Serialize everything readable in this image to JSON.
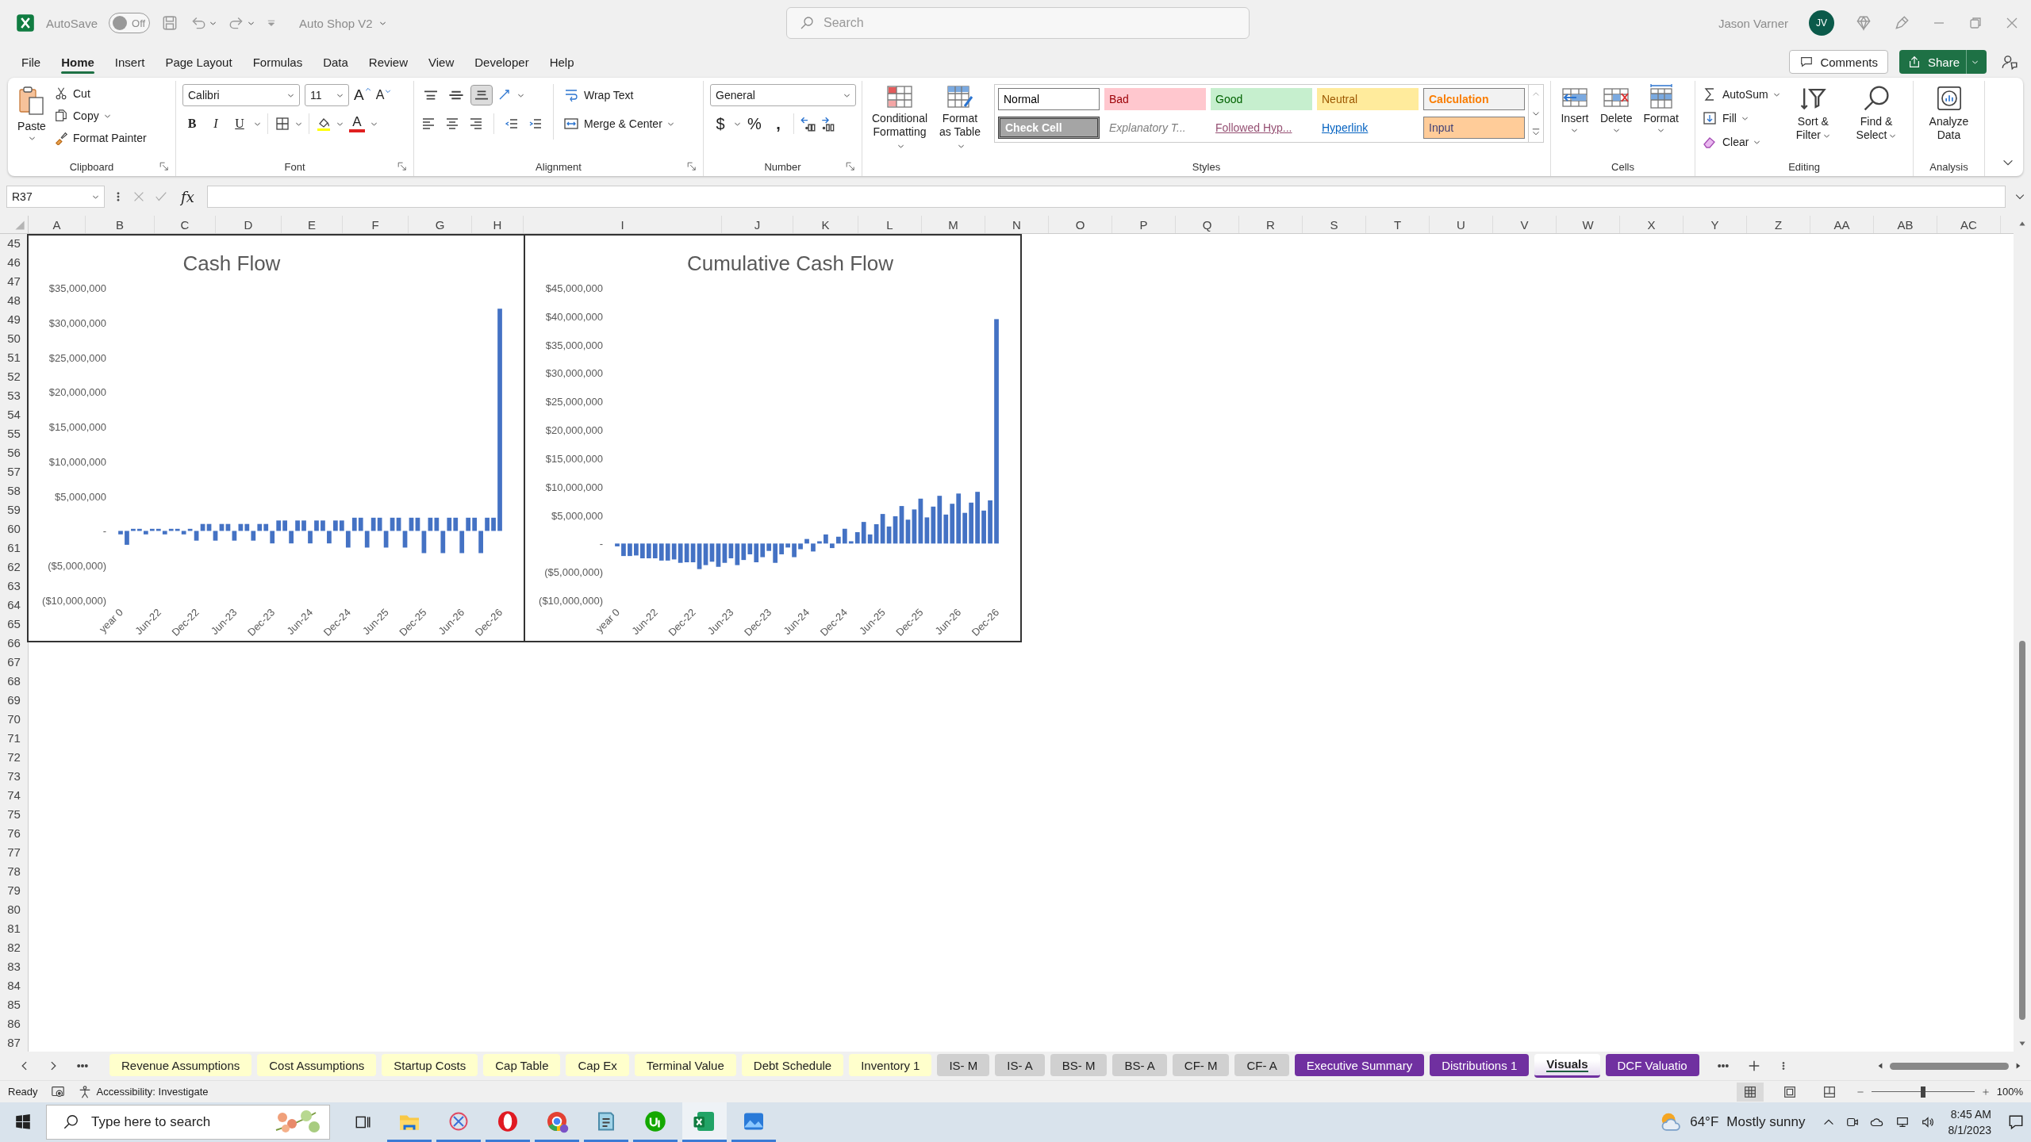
{
  "title_bar": {
    "autosave": {
      "label": "AutoSave",
      "on": false,
      "state": "Off"
    },
    "document": "Auto Shop V2",
    "search": {
      "placeholder": "Search"
    },
    "user": {
      "name": "Jason Varner",
      "initials": "JV"
    }
  },
  "menu": {
    "tabs": [
      {
        "label": "File",
        "selected": false
      },
      {
        "label": "Home",
        "selected": true
      },
      {
        "label": "Insert",
        "selected": false
      },
      {
        "label": "Page Layout",
        "selected": false
      },
      {
        "label": "Formulas",
        "selected": false
      },
      {
        "label": "Data",
        "selected": false
      },
      {
        "label": "Review",
        "selected": false
      },
      {
        "label": "View",
        "selected": false
      },
      {
        "label": "Developer",
        "selected": false
      },
      {
        "label": "Help",
        "selected": false
      }
    ],
    "comments": "Comments",
    "share": "Share"
  },
  "ribbon": {
    "clipboard": {
      "label": "Clipboard",
      "paste": "Paste",
      "commands": [
        "Cut",
        "Copy",
        "Format Painter"
      ]
    },
    "font": {
      "label": "Font",
      "face": "Calibri",
      "size": "11",
      "grow": "A",
      "shrink": "A",
      "styles": [
        "B",
        "I",
        "U"
      ],
      "color_letter": "A"
    },
    "alignment": {
      "label": "Alignment",
      "vertical": [
        {
          "kind": "top",
          "selected": false
        },
        {
          "kind": "middle",
          "selected": false
        },
        {
          "kind": "bottom",
          "selected": true
        }
      ],
      "wrap": "Wrap Text",
      "merge": "Merge & Center"
    },
    "number": {
      "label": "Number",
      "format": "General",
      "symbols": [
        "$",
        "%",
        ","
      ]
    },
    "styles": {
      "label": "Styles",
      "commands": [
        "Conditional Formatting",
        "Format as Table"
      ],
      "gallery": [
        {
          "label": "Normal",
          "kind": "normal"
        },
        {
          "label": "Bad",
          "kind": "bad"
        },
        {
          "label": "Good",
          "kind": "good"
        },
        {
          "label": "Neutral",
          "kind": "neutral"
        },
        {
          "label": "Calculation",
          "kind": "calculation"
        },
        {
          "label": "Check Cell",
          "kind": "check"
        },
        {
          "label": "Explanatory T...",
          "kind": "explanatory"
        },
        {
          "label": "Followed Hyp...",
          "kind": "followed"
        },
        {
          "label": "Hyperlink",
          "kind": "hyperlink"
        },
        {
          "label": "Input",
          "kind": "input"
        }
      ]
    },
    "cells": {
      "label": "Cells",
      "commands": [
        "Insert",
        "Delete",
        "Format"
      ]
    },
    "editing": {
      "label": "Editing",
      "commands": [
        "AutoSum",
        "Fill",
        "Clear"
      ],
      "large": [
        "Sort & Filter",
        "Find & Select"
      ]
    },
    "analysis": {
      "label": "Analysis",
      "commands": [
        "Analyze Data"
      ]
    }
  },
  "formula_bar": {
    "name_box": "R37",
    "fx": "fx"
  },
  "sheet": {
    "columns": [
      "A",
      "B",
      "C",
      "D",
      "E",
      "F",
      "G",
      "H",
      "I",
      "J",
      "K",
      "L",
      "M",
      "N",
      "O",
      "P",
      "Q",
      "R",
      "S",
      "T",
      "U",
      "V",
      "W",
      "X",
      "Y",
      "Z",
      "AA",
      "AB",
      "AC"
    ],
    "rows": [
      "45",
      "46",
      "47",
      "48",
      "49",
      "50",
      "51",
      "52",
      "53",
      "54",
      "55",
      "56",
      "57",
      "58",
      "59",
      "60",
      "61",
      "62",
      "63",
      "64",
      "65",
      "66",
      "67",
      "68",
      "69",
      "70",
      "71",
      "72",
      "73",
      "74",
      "75",
      "76",
      "77",
      "78",
      "79",
      "80",
      "81",
      "82",
      "83",
      "84",
      "85",
      "86",
      "87"
    ],
    "charts": [
      {
        "chart_data": {
          "type": "bar",
          "title": "Cash Flow",
          "categories": [
            "year 0",
            null,
            null,
            null,
            null,
            null,
            "Jun-22",
            null,
            null,
            null,
            null,
            null,
            "Dec-22",
            null,
            null,
            null,
            null,
            null,
            "Jun-23",
            null,
            null,
            null,
            null,
            null,
            "Dec-23",
            null,
            null,
            null,
            null,
            null,
            "Jun-24",
            null,
            null,
            null,
            null,
            null,
            "Dec-24",
            null,
            null,
            null,
            null,
            null,
            "Jun-25",
            null,
            null,
            null,
            null,
            null,
            "Dec-25",
            null,
            null,
            null,
            null,
            null,
            "Jun-26",
            null,
            null,
            null,
            null,
            null,
            "Dec-26"
          ],
          "values": [
            -500000,
            -2000000,
            300000,
            300000,
            -500000,
            300000,
            300000,
            -500000,
            300000,
            300000,
            -500000,
            300000,
            -1400000,
            1000000,
            1000000,
            -1400000,
            1000000,
            1000000,
            -1400000,
            1000000,
            1000000,
            -1400000,
            1000000,
            1000000,
            -1800000,
            1500000,
            1500000,
            -1800000,
            1500000,
            1500000,
            -1800000,
            1500000,
            1500000,
            -1800000,
            1500000,
            1500000,
            -2400000,
            1900000,
            1900000,
            -2400000,
            1900000,
            1900000,
            -2400000,
            1900000,
            1900000,
            -2400000,
            1900000,
            1900000,
            -3200000,
            1900000,
            1900000,
            -3200000,
            1900000,
            1900000,
            -3200000,
            1900000,
            1900000,
            -3200000,
            1900000,
            1900000,
            32000000
          ],
          "ylim": [
            -10000000,
            35000000
          ],
          "yticks": [
            {
              "value": 35000000,
              "label": "$35,000,000"
            },
            {
              "value": 30000000,
              "label": "$30,000,000"
            },
            {
              "value": 25000000,
              "label": "$25,000,000"
            },
            {
              "value": 20000000,
              "label": "$20,000,000"
            },
            {
              "value": 15000000,
              "label": "$15,000,000"
            },
            {
              "value": 10000000,
              "label": "$10,000,000"
            },
            {
              "value": 5000000,
              "label": "$5,000,000"
            },
            {
              "value": 0,
              "label": "-"
            },
            {
              "value": -5000000,
              "label": "($5,000,000)"
            },
            {
              "value": -10000000,
              "label": "($10,000,000)"
            }
          ]
        }
      },
      {
        "chart_data": {
          "type": "bar",
          "title": "Cumulative Cash Flow",
          "categories": [
            "year 0",
            null,
            null,
            null,
            null,
            null,
            "Jun-22",
            null,
            null,
            null,
            null,
            null,
            "Dec-22",
            null,
            null,
            null,
            null,
            null,
            "Jun-23",
            null,
            null,
            null,
            null,
            null,
            "Dec-23",
            null,
            null,
            null,
            null,
            null,
            "Jun-24",
            null,
            null,
            null,
            null,
            null,
            "Dec-24",
            null,
            null,
            null,
            null,
            null,
            "Jun-25",
            null,
            null,
            null,
            null,
            null,
            "Dec-25",
            null,
            null,
            null,
            null,
            null,
            "Jun-26",
            null,
            null,
            null,
            null,
            null,
            "Dec-26"
          ],
          "values": [
            -500000,
            -2200000,
            -2200000,
            -2100000,
            -2600000,
            -2600000,
            -2600000,
            -3000000,
            -3000000,
            -2800000,
            -3400000,
            -3300000,
            -3300000,
            -4500000,
            -3800000,
            -3200000,
            -4100000,
            -3400000,
            -2600000,
            -3800000,
            -2900000,
            -1900000,
            -3300000,
            -2400000,
            -1300000,
            -3400000,
            -1900000,
            -700000,
            -2400000,
            -1000000,
            800000,
            -1400000,
            400000,
            1600000,
            -800000,
            1200000,
            2600000,
            400000,
            2000000,
            3800000,
            1600000,
            3400000,
            5200000,
            3000000,
            4800000,
            6600000,
            4200000,
            6000000,
            7900000,
            4600000,
            6500000,
            8400000,
            5100000,
            7000000,
            8800000,
            5400000,
            7200000,
            9100000,
            5800000,
            7600000,
            39500000
          ],
          "ylim": [
            -10000000,
            45000000
          ],
          "yticks": [
            {
              "value": 45000000,
              "label": "$45,000,000"
            },
            {
              "value": 40000000,
              "label": "$40,000,000"
            },
            {
              "value": 35000000,
              "label": "$35,000,000"
            },
            {
              "value": 30000000,
              "label": "$30,000,000"
            },
            {
              "value": 25000000,
              "label": "$25,000,000"
            },
            {
              "value": 20000000,
              "label": "$20,000,000"
            },
            {
              "value": 15000000,
              "label": "$15,000,000"
            },
            {
              "value": 10000000,
              "label": "$10,000,000"
            },
            {
              "value": 5000000,
              "label": "$5,000,000"
            },
            {
              "value": 0,
              "label": "-"
            },
            {
              "value": -5000000,
              "label": "($5,000,000)"
            },
            {
              "value": -10000000,
              "label": "($10,000,000)"
            }
          ]
        }
      }
    ]
  },
  "sheet_tabs": [
    {
      "label": "Revenue Assumptions",
      "color": "#ffffcc",
      "selected": false
    },
    {
      "label": "Cost Assumptions",
      "color": "#ffffcc",
      "selected": false
    },
    {
      "label": "Startup Costs",
      "color": "#ffffcc",
      "selected": false
    },
    {
      "label": "Cap Table",
      "color": "#ffffcc",
      "selected": false
    },
    {
      "label": "Cap Ex",
      "color": "#ffffcc",
      "selected": false
    },
    {
      "label": "Terminal Value",
      "color": "#ffffcc",
      "selected": false
    },
    {
      "label": "Debt Schedule",
      "color": "#ffffcc",
      "selected": false
    },
    {
      "label": "Inventory 1",
      "color": "#ffffcc",
      "selected": false
    },
    {
      "label": "IS- M",
      "color": "#d0d0d0",
      "selected": false
    },
    {
      "label": "IS- A",
      "color": "#d0d0d0",
      "selected": false
    },
    {
      "label": "BS- M",
      "color": "#d0d0d0",
      "selected": false
    },
    {
      "label": "BS- A",
      "color": "#d0d0d0",
      "selected": false
    },
    {
      "label": "CF- M",
      "color": "#d0d0d0",
      "selected": false
    },
    {
      "label": "CF- A",
      "color": "#d0d0d0",
      "selected": false
    },
    {
      "label": "Executive Summary",
      "color": "#7030a0",
      "selected": false
    },
    {
      "label": "Distributions 1",
      "color": "#7030a0",
      "selected": false
    },
    {
      "label": "Visuals",
      "color": "#7030a0",
      "selected": true
    },
    {
      "label": "DCF Valuatio",
      "color": "#7030a0",
      "selected": false
    }
  ],
  "status_bar": {
    "mode": "Ready",
    "accessibility": "Accessibility: Investigate",
    "zoom": {
      "level": 0.5,
      "reading": "100%"
    }
  },
  "taskbar": {
    "search": {
      "placeholder": "Type here to search"
    },
    "apps": [
      {
        "kind": "explorer",
        "active": false
      },
      {
        "kind": "snipping",
        "active": false
      },
      {
        "kind": "opera",
        "active": false
      },
      {
        "kind": "chrome",
        "active": false
      },
      {
        "kind": "notepad",
        "active": false
      },
      {
        "kind": "upwork",
        "active": false
      },
      {
        "kind": "excel",
        "active": true
      },
      {
        "kind": "photos",
        "active": false
      }
    ],
    "weather": {
      "temperature": "64°F",
      "condition": "Mostly sunny"
    },
    "time": "8:45 AM",
    "date": "8/1/2023"
  }
}
